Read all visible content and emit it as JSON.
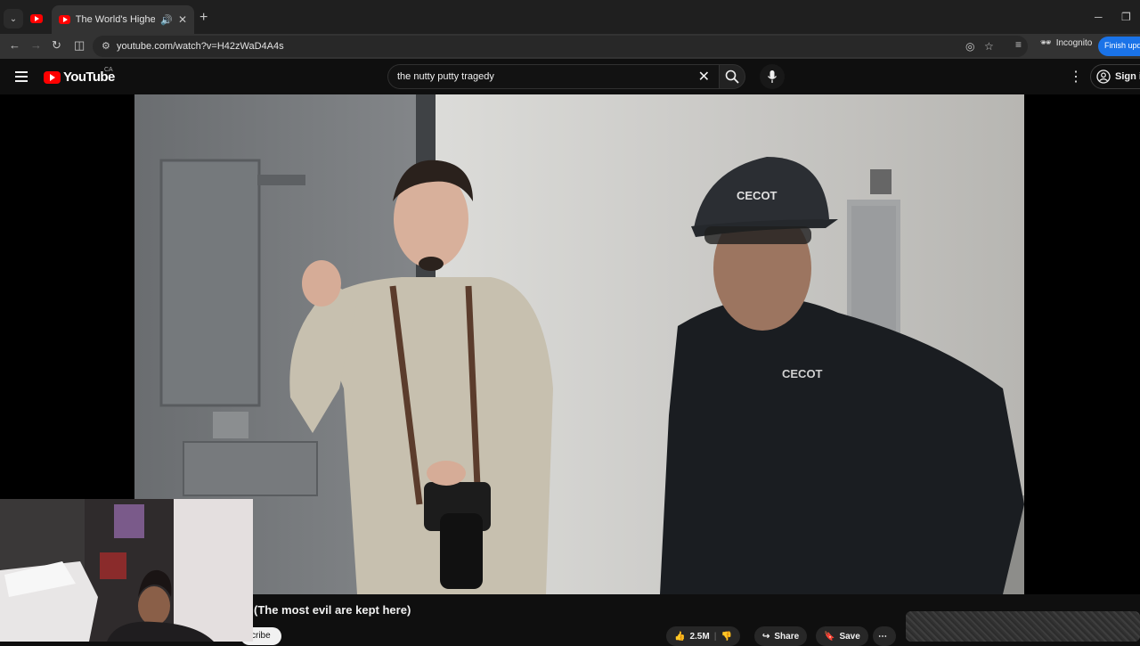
{
  "browser": {
    "tab_title": "The World's Highest Security",
    "url": "youtube.com/watch?v=H42zWaD4A4s",
    "incognito_label": "Incognito",
    "finish_update_label": "Finish update"
  },
  "youtube": {
    "logo_text": "YouTube",
    "country_code": "CA",
    "search_query": "the nutty putty tragedy",
    "signin_label": "Sign in"
  },
  "video": {
    "title_visible": "(The most evil are kept here)",
    "subscribe_partial": "cribe",
    "likes": "2.5M",
    "share_label": "Share",
    "save_label": "Save",
    "cap_text": "CECOT",
    "shirt_text": "CECOT"
  },
  "colors": {
    "accent": "#ff0000",
    "finish_update": "#1a73e8"
  }
}
